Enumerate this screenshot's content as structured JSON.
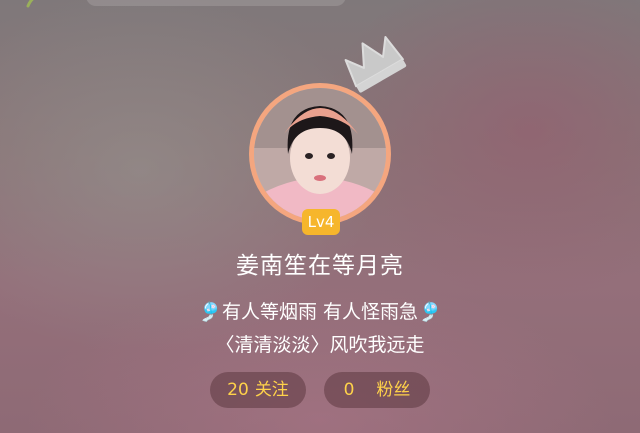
{
  "profile": {
    "level": "Lv4",
    "username": "姜南笙在等月亮",
    "bio_line1": "🎐有人等烟雨 有人怪雨急🎐",
    "bio_line2": "〈清清淡淡〉风吹我远走"
  },
  "stats": {
    "following_count": "20",
    "following_label": "关注",
    "fans_count": "0",
    "fans_label": "粉丝"
  },
  "icons": {
    "crown": "crown-icon",
    "corner": "leaf-icon"
  },
  "colors": {
    "avatar_ring": "#f4a67f",
    "level_badge": "#f6b62c",
    "stat_text": "#ffd24a"
  }
}
